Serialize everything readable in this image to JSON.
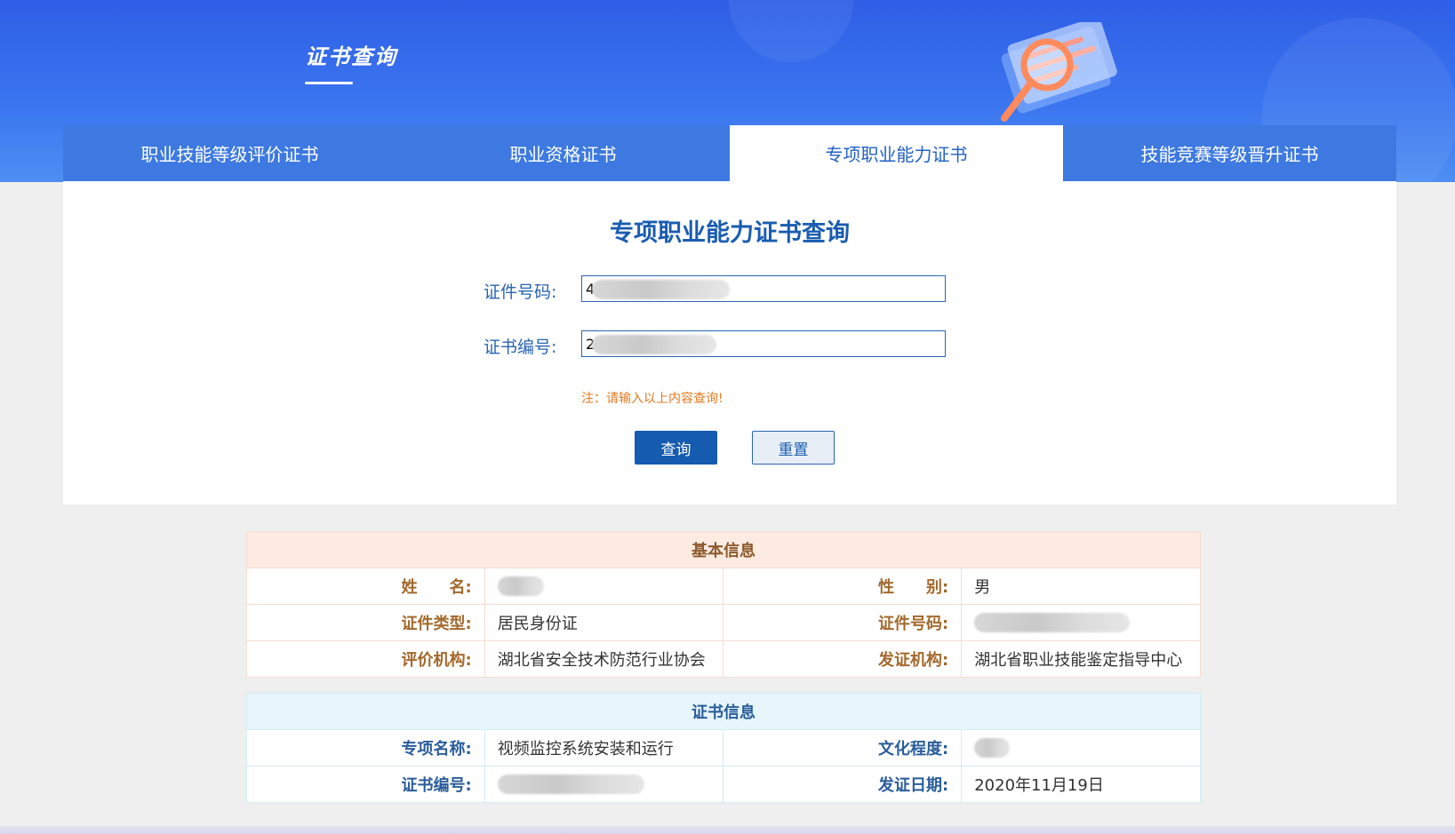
{
  "header": {
    "title": "证书查询"
  },
  "tabs": [
    {
      "label": "职业技能等级评价证书",
      "active": false
    },
    {
      "label": "职业资格证书",
      "active": false
    },
    {
      "label": "专项职业能力证书",
      "active": true
    },
    {
      "label": "技能竞赛等级晋升证书",
      "active": false
    }
  ],
  "search": {
    "title": "专项职业能力证书查询",
    "id_label": "证件号码:",
    "id_value": "4",
    "cert_label": "证书编号:",
    "cert_value": "2",
    "note": "注：请输入以上内容查询!",
    "query_button": "查询",
    "reset_button": "重置"
  },
  "basic_info": {
    "header": "基本信息",
    "name_label": "姓　　名:",
    "name_value": "",
    "gender_label": "性　　别:",
    "gender_value": "男",
    "id_type_label": "证件类型:",
    "id_type_value": "居民身份证",
    "id_number_label": "证件号码:",
    "id_number_value": "",
    "eval_org_label": "评价机构:",
    "eval_org_value": "湖北省安全技术防范行业协会",
    "issuer_label": "发证机构:",
    "issuer_value": "湖北省职业技能鉴定指导中心"
  },
  "cert_info": {
    "header": "证书信息",
    "item_label": "专项名称:",
    "item_value": "视频监控系统安装和运行",
    "edu_label": "文化程度:",
    "edu_value": "",
    "cert_no_label": "证书编号:",
    "cert_no_value": "",
    "issue_date_label": "发证日期:",
    "issue_date_value": "2020年11月19日"
  },
  "colors": {
    "hero_blue": "#3a74ef",
    "tab_blue": "#3d79e0",
    "title_blue": "#1a5cb0",
    "note_orange": "#e27a1f",
    "basic_label_brown": "#a3692c"
  }
}
